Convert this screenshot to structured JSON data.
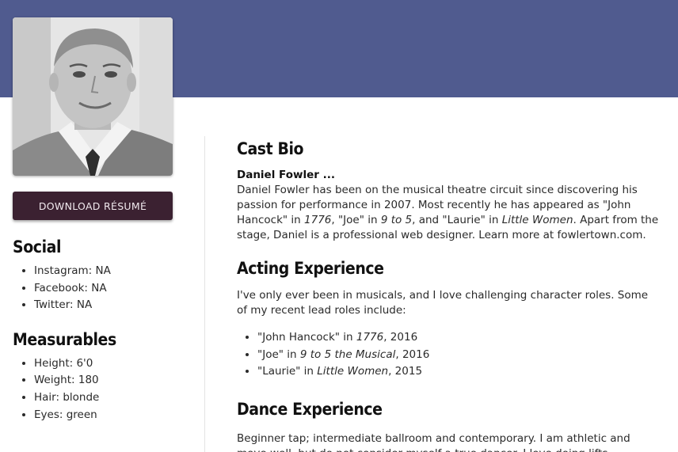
{
  "sidebar": {
    "download_label": "DOWNLOAD RÉSUMÉ",
    "social": {
      "heading": "Social",
      "items": [
        "Instagram: NA",
        "Facebook: NA",
        "Twitter: NA"
      ]
    },
    "measurables": {
      "heading": "Measurables",
      "items": [
        "Height: 6'0",
        "Weight: 180",
        "Hair: blonde",
        "Eyes: green"
      ]
    }
  },
  "bio": {
    "heading": "Cast Bio",
    "name": "Daniel Fowler ...",
    "p1": "Daniel Fowler has been on the musical theatre circuit since discovering his passion for performance in 2007. Most recently he has appeared as \"John Hancock\" in ",
    "show1": "1776",
    "p2": ", \"Joe\" in ",
    "show2": "9 to 5",
    "p3": ", and \"Laurie\" in ",
    "show3": "Little Women",
    "p4": ". Apart from the stage, Daniel is a professional web designer. Learn more at fowlertown.com."
  },
  "acting": {
    "heading": "Acting Experience",
    "intro": "I've only ever been in musicals, and I love challenging character roles. Some of my recent lead roles include:",
    "roles": [
      {
        "role": "\"John Hancock\" in ",
        "show": "1776",
        "year": ", 2016"
      },
      {
        "role": "\"Joe\" in ",
        "show": "9 to 5 the Musical",
        "year": ", 2016"
      },
      {
        "role": "\"Laurie\" in ",
        "show": "Little Women",
        "year": ", 2015"
      }
    ]
  },
  "dance": {
    "heading": "Dance Experience",
    "text": "Beginner tap; intermediate ballroom and contemporary. I am athletic and move well, but do not consider myself a true dancer. I love doing lifts."
  },
  "colors": {
    "banner": "#505b8f",
    "button": "#3b2131",
    "button_text": "#f1e9ee"
  }
}
